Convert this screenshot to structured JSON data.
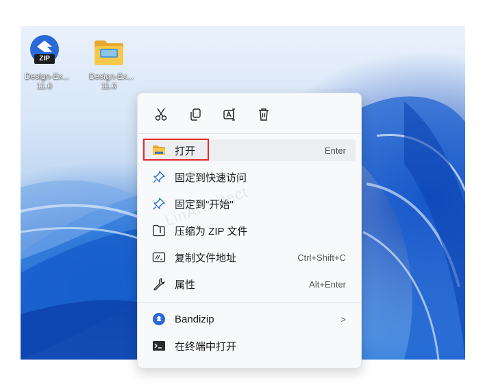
{
  "desktop_icons": [
    {
      "name": "Design-Ex...",
      "version": "11.0",
      "badge": "ZIP",
      "icon": "bandizip-zip-icon"
    },
    {
      "name": "Design-Ex...",
      "version": "11.0",
      "icon": "folder-icon"
    }
  ],
  "context_menu": {
    "actions": [
      {
        "name": "cut",
        "icon": "scissors-icon"
      },
      {
        "name": "copy",
        "icon": "copy-icon"
      },
      {
        "name": "rename",
        "icon": "rename-icon"
      },
      {
        "name": "delete",
        "icon": "trash-icon"
      }
    ],
    "items": [
      {
        "label": "打开",
        "shortcut": "Enter",
        "icon": "folder-open-icon"
      },
      {
        "label": "固定到快速访问",
        "icon": "pin-icon"
      },
      {
        "label": "固定到\"开始\"",
        "icon": "pin-icon"
      },
      {
        "label": "压缩为 ZIP 文件",
        "icon": "zip-folder-icon"
      },
      {
        "label": "复制文件地址",
        "shortcut": "Ctrl+Shift+C",
        "icon": "path-icon"
      },
      {
        "label": "属性",
        "shortcut": "Alt+Enter",
        "icon": "wrench-icon"
      },
      {
        "label": "Bandizip",
        "shortcut": ">",
        "icon": "bandizip-icon"
      },
      {
        "label": "在终端中打开",
        "icon": "terminal-icon"
      }
    ]
  },
  "watermark": "LinArchitect",
  "colors": {
    "highlight_outline": "#e8262d",
    "menu_bg": "#f8f9fb",
    "bandizip_blue": "#2a6ad8"
  }
}
